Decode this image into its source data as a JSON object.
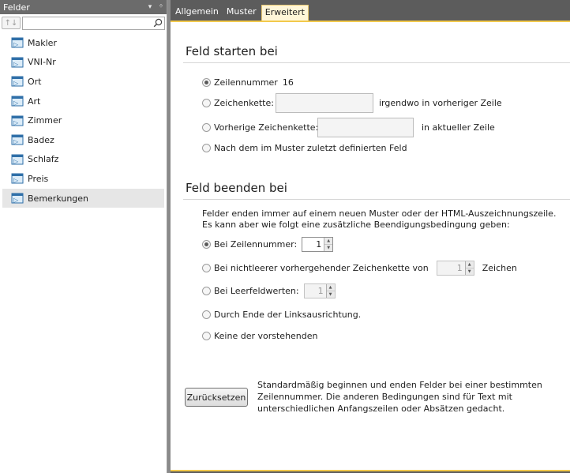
{
  "left_panel": {
    "title": "Felder",
    "controls": [
      "▾",
      "ᛜ"
    ],
    "sort_label": "↑↓",
    "search": {
      "value": "",
      "placeholder": ""
    },
    "fields": [
      {
        "label": "Makler",
        "selected": false
      },
      {
        "label": "VNI-Nr",
        "selected": false
      },
      {
        "label": "Ort",
        "selected": false
      },
      {
        "label": "Art",
        "selected": false
      },
      {
        "label": "Zimmer",
        "selected": false
      },
      {
        "label": "Badez",
        "selected": false
      },
      {
        "label": "Schlafz",
        "selected": false
      },
      {
        "label": "Preis",
        "selected": false
      },
      {
        "label": "Bemerkungen",
        "selected": true
      }
    ]
  },
  "tabs": [
    {
      "label": "Allgemein",
      "active": false
    },
    {
      "label": "Muster",
      "active": false
    },
    {
      "label": "Erweitert",
      "active": true
    }
  ],
  "start_section": {
    "title": "Feld starten bei",
    "options": {
      "line_number": {
        "label": "Zeilennummer",
        "value": "16",
        "checked": true
      },
      "string": {
        "label": "Zeichenkette:",
        "value": "",
        "suffix": "irgendwo in vorheriger Zeile",
        "checked": false
      },
      "prev_string": {
        "label": "Vorherige Zeichenkette:",
        "value": "",
        "suffix": "in aktueller Zeile",
        "checked": false
      },
      "after_field": {
        "label": "Nach dem im Muster zuletzt definierten Feld",
        "checked": false
      }
    }
  },
  "end_section": {
    "title": "Feld beenden bei",
    "intro_1": "Felder enden immer auf einem neuen Muster oder der HTML-Auszeichnungszeile.",
    "intro_2": "Es kann aber wie folgt eine zusätzliche Beendigungsbedingung geben:",
    "options": {
      "line_number": {
        "label": "Bei Zeilennummer:",
        "value": "1",
        "checked": true
      },
      "nonempty": {
        "label": "Bei nichtleerer vorhergehender Zeichenkette von",
        "value": "1",
        "suffix": "Zeichen",
        "checked": false
      },
      "empty_values": {
        "label": "Bei Leerfeldwerten:",
        "value": "1",
        "checked": false
      },
      "left_align": {
        "label": "Durch Ende der Linksausrichtung.",
        "checked": false
      },
      "none": {
        "label": "Keine der vorstehenden",
        "checked": false
      }
    }
  },
  "reset": {
    "button_label": "Zurücksetzen",
    "desc_1": "Standardmäßig beginnen und enden Felder bei einer bestimmten",
    "desc_2": "Zeilennummer. Die anderen Bedingungen sind für Text mit",
    "desc_3": "unterschiedlichen Anfangszeilen oder Absätzen gedacht."
  },
  "colors": {
    "accent": "#f2c94c",
    "panel_header": "#6b6b6b",
    "background": "#5c5c5c"
  }
}
